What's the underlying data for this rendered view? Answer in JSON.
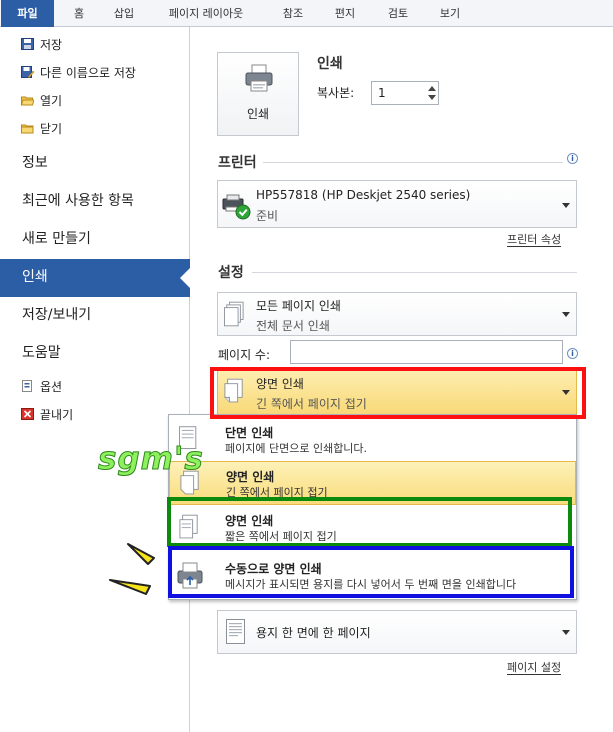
{
  "ribbon": {
    "tabs": [
      "파일",
      "홈",
      "삽입",
      "페이지 레이아웃",
      "참조",
      "편지",
      "검토",
      "보기"
    ]
  },
  "nav": {
    "save": "저장",
    "save_as": "다른 이름으로 저장",
    "open": "열기",
    "close": "닫기",
    "info": "정보",
    "recent": "최근에 사용한 항목",
    "new": "새로 만들기",
    "print": "인쇄",
    "save_send": "저장/보내기",
    "help": "도움말",
    "options": "옵션",
    "exit": "끝내기"
  },
  "print": {
    "section_title": "인쇄",
    "button_label": "인쇄",
    "copies_label": "복사본:",
    "copies_value": "1"
  },
  "printer": {
    "section_title": "프린터",
    "name": "HP557818 (HP Deskjet 2540 series)",
    "status": "준비",
    "properties_link": "프린터 속성"
  },
  "settings": {
    "section_title": "설정",
    "range_title": "모든 페이지 인쇄",
    "range_desc": "전체 문서 인쇄",
    "pages_label": "페이지 수:",
    "pages_value": "",
    "duplex_title": "양면 인쇄",
    "duplex_desc": "긴 쪽에서 페이지 접기",
    "sheet_title": "용지 한 면에 한 페이지",
    "page_setup_link": "페이지 설정"
  },
  "popup": {
    "options": [
      {
        "title": "단면 인쇄",
        "desc": "페이지에 단면으로 인쇄합니다."
      },
      {
        "title": "양면 인쇄",
        "desc": "긴 쪽에서 페이지 접기"
      },
      {
        "title": "양면 인쇄",
        "desc": "짧은 쪽에서 페이지 접기"
      },
      {
        "title": "수동으로 양면 인쇄",
        "desc": "메시지가 표시되면 용지를 다시 넣어서 두 번째 면을 인쇄합니다"
      }
    ]
  },
  "watermark": "sgm's",
  "colors": {
    "accent": "#2c5ea6",
    "highlight_red": "#ff1010",
    "highlight_green": "#0b8a0b",
    "highlight_blue": "#1010e0",
    "selected_bg": "#f9dc7c"
  }
}
